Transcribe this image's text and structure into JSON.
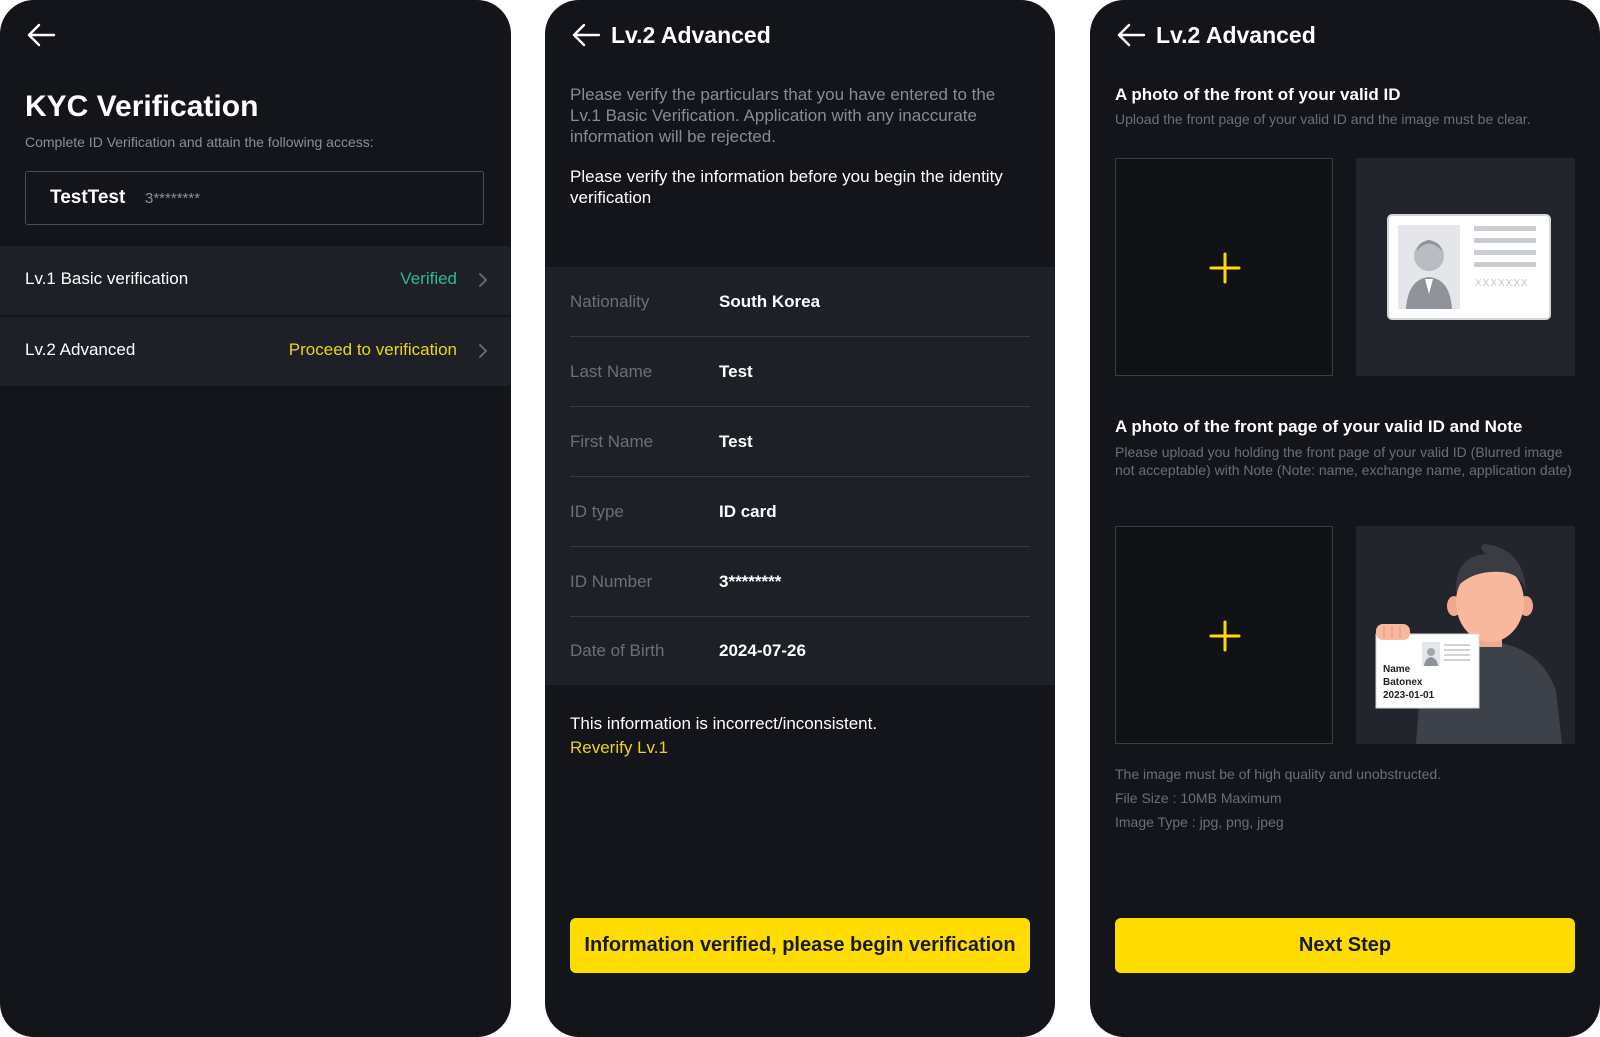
{
  "screen1": {
    "title": "KYC Verification",
    "subtitle": "Complete ID Verification and attain the following access:",
    "user_name": "TestTest",
    "user_id": "3********",
    "levels": [
      {
        "label": "Lv.1 Basic verification",
        "status": "Verified",
        "status_color": "#2fb98e"
      },
      {
        "label": "Lv.2 Advanced",
        "status": "Proceed to verification",
        "status_color": "#ecd417"
      }
    ]
  },
  "screen2": {
    "title": "Lv.2 Advanced",
    "intro": "Please verify the particulars that you have entered to the Lv.1 Basic Verification. Application with any inaccurate information will be rejected.",
    "intro2": "Please verify the information before you begin the identity verification",
    "fields": [
      {
        "label": "Nationality",
        "value": "South Korea"
      },
      {
        "label": "Last Name",
        "value": "Test"
      },
      {
        "label": "First Name",
        "value": "Test"
      },
      {
        "label": "ID type",
        "value": "ID card"
      },
      {
        "label": "ID Number",
        "value": "3********"
      },
      {
        "label": "Date of Birth",
        "value": "2024-07-26"
      }
    ],
    "incorrect_text": "This information is incorrect/inconsistent.",
    "reverify_link": "Reverify Lv.1",
    "button": "Information verified, please begin verification"
  },
  "screen3": {
    "title": "Lv.2 Advanced",
    "section1_title": "A photo of the front of your valid ID",
    "section1_desc": "Upload the front page of your valid ID and the image must be clear.",
    "section2_title": "A photo of the front page of your valid ID and Note",
    "section2_desc": "Please upload you holding the front page of your valid ID (Blurred image not acceptable) with Note (Note: name, exchange name, application date)",
    "sample_id_text": "XXXXXXX",
    "note_name_label": "Name",
    "note_exchange": "Batonex",
    "note_date": "2023-01-01",
    "requirements": [
      "The image must be of high quality and unobstructed.",
      "File Size : 10MB Maximum",
      "Image Type : jpg, png, jpeg"
    ],
    "button": "Next Step"
  },
  "colors": {
    "background": "#13151a",
    "panel": "#1d2027",
    "accent_yellow": "#fedc00",
    "verified_green": "#2fb98e"
  }
}
